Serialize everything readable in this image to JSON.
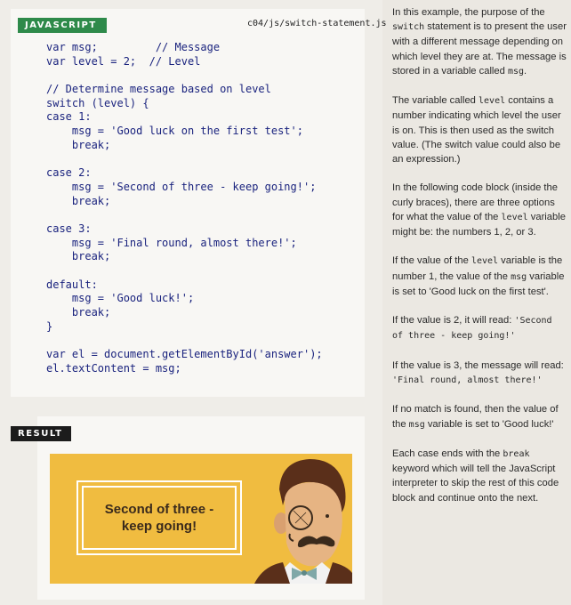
{
  "code_panel": {
    "label": "JAVASCRIPT",
    "filename": "c04/js/switch-statement.js",
    "lines": [
      "var msg;         // Message",
      "var level = 2;  // Level",
      "",
      "// Determine message based on level",
      "switch (level) {",
      "case 1:",
      "    msg = 'Good luck on the first test';",
      "    break;",
      "",
      "case 2:",
      "    msg = 'Second of three - keep going!';",
      "    break;",
      "",
      "case 3:",
      "    msg = 'Final round, almost there!';",
      "    break;",
      "",
      "default:",
      "    msg = 'Good luck!';",
      "    break;",
      "}",
      "",
      "var el = document.getElementById('answer');",
      "el.textContent = msg;"
    ]
  },
  "result": {
    "label": "RESULT",
    "message": "Second of three - keep going!"
  },
  "description": {
    "p1": [
      "In this example, the purpose of the ",
      "switch",
      " statement is to present the user with a different message depending on which level they are at. The message is stored in a variable called ",
      "msg",
      "."
    ],
    "p2": [
      "The variable called ",
      "level",
      " contains a number indicating which level the user is on. This is then used as the switch value. (The switch value could also be an expression.)"
    ],
    "p3": [
      "In the following code block (inside the curly braces), there are three options for what the value of the ",
      "level",
      " variable might be: the numbers 1, 2, or 3."
    ],
    "p4": [
      "If the value of the ",
      "level",
      " variable is the number 1, the value of the ",
      "msg",
      " variable is set to 'Good luck on the first test'."
    ],
    "p5": [
      "If the value is 2, it will read: ",
      "'Second of three - keep going!'",
      ""
    ],
    "p6": [
      "If the value is 3, the message will read: ",
      "'Final round, almost there!'",
      ""
    ],
    "p7": [
      "If no match is found, then the value of the ",
      "msg",
      " variable is set to 'Good luck!'"
    ],
    "p8": [
      "Each case ends with the ",
      "break",
      " keyword which will tell the JavaScript interpreter to skip the rest of this code block and continue onto the next."
    ]
  },
  "colors": {
    "label_green": "#2e8a4a",
    "label_black": "#1c1c1c",
    "banner_yellow": "#f0bc40",
    "code_blue": "#1a237e"
  }
}
